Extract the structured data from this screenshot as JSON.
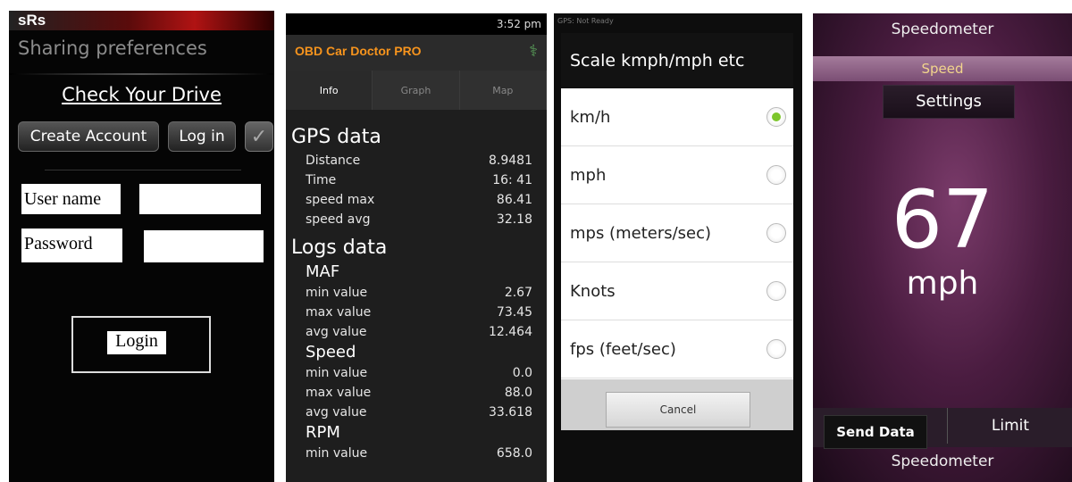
{
  "screen1": {
    "logo": "sRs",
    "header": "Sharing preferences",
    "heading": "Check Your Drive",
    "create_account": "Create Account",
    "log_in": "Log in",
    "checkmark": "✓",
    "username_label": "User name",
    "password_label": "Password",
    "login_button": "Login"
  },
  "screen2": {
    "status_time": "3:52 pm",
    "app_title": "OBD Car Doctor PRO",
    "tabs": [
      "Info",
      "Graph",
      "Map"
    ],
    "gps_title": "GPS data",
    "gps_rows": [
      {
        "label": "Distance",
        "value": "8.9481"
      },
      {
        "label": "Time",
        "value": "16: 41"
      },
      {
        "label": "speed max",
        "value": "86.41"
      },
      {
        "label": "speed avg",
        "value": "32.18"
      }
    ],
    "logs_title": "Logs data",
    "maf": {
      "title": "MAF",
      "rows": [
        {
          "label": "min value",
          "value": "2.67"
        },
        {
          "label": "max value",
          "value": "73.45"
        },
        {
          "label": "avg value",
          "value": "12.464"
        }
      ]
    },
    "speed": {
      "title": "Speed",
      "rows": [
        {
          "label": "min value",
          "value": "0.0"
        },
        {
          "label": "max value",
          "value": "88.0"
        },
        {
          "label": "avg value",
          "value": "33.618"
        }
      ]
    },
    "rpm": {
      "title": "RPM",
      "rows": [
        {
          "label": "min value",
          "value": "658.0"
        }
      ]
    }
  },
  "screen3": {
    "status": "GPS: Not Ready",
    "dialog_title": "Scale kmph/mph etc",
    "options": [
      "km/h",
      "mph",
      "mps (meters/sec)",
      "Knots",
      "fps (feet/sec)"
    ],
    "selected_index": 0,
    "cancel": "Cancel"
  },
  "screen4": {
    "title": "Speedometer",
    "speed_tab": "Speed",
    "settings": "Settings",
    "speed_value": "67",
    "unit": "mph",
    "send_data": "Send Data",
    "limit": "Limit",
    "footer": "Speedometer"
  }
}
